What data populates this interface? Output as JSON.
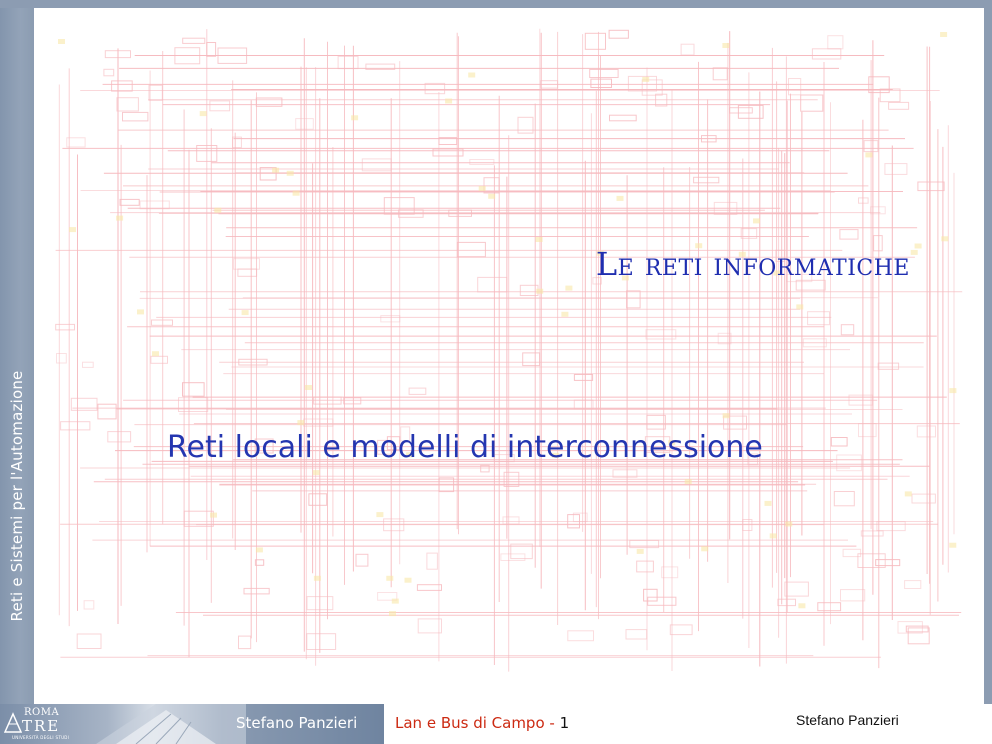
{
  "sidebar": {
    "vertical_text": "Reti e Sistemi per l'Automazione"
  },
  "slide": {
    "title": "Le reti informatiche",
    "subtitle": "Reti locali e modelli di interconnessione"
  },
  "footer": {
    "logo": {
      "roma": "ROMA",
      "tre": "TRE",
      "university": "UNIVERSITÀ DEGLI STUDI"
    },
    "author_left": "Stefano Panzieri",
    "course": "Lan e Bus di Campo",
    "separator": "-",
    "page_number": "1",
    "author_right": "Stefano Panzieri"
  },
  "colors": {
    "frame": "#8c9cb2",
    "title": "#1f2eb0",
    "circuit": "#f6b9be",
    "course": "#cc2a12"
  }
}
